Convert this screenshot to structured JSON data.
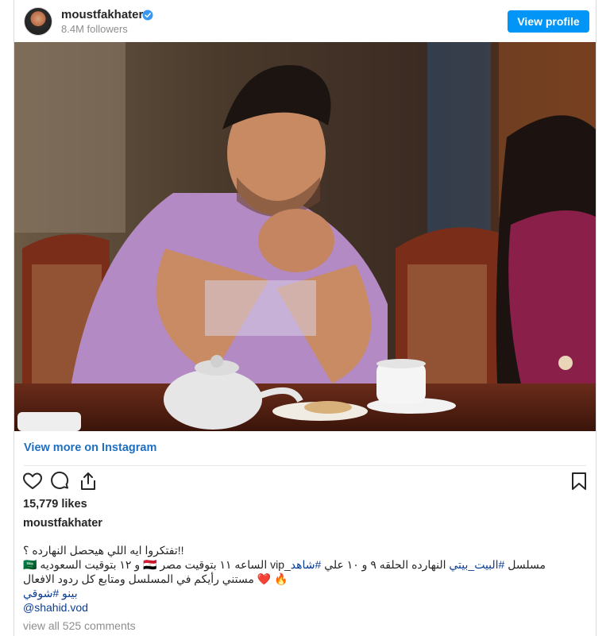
{
  "header": {
    "username": "moustfakhater",
    "followers": "8.4M followers",
    "view_profile_label": "View profile"
  },
  "post": {
    "photo_alt": "",
    "view_more_label": "View more on Instagram",
    "likes": "15,779 likes",
    "owner": "moustfakhater",
    "caption": {
      "line1": "!!تفتكروا ايه اللي هيحصل النهارده ؟",
      "line2_pre": "🇸🇦 و ١٢ بتوقيت السعوديه 🇪🇬 الساعه ١١ بتوقيت مصر ",
      "line2_tag1": "#البيت_بيتي",
      "line2_mid": " vip_مسلسل ",
      "line2_tag0": "",
      "line2_post": " النهارده الحلقه ٩ و ١٠ علي ",
      "line2_tag2": "#شاهد",
      "line3": "🔥 ❤️ مستني رأيكم في المسلسل ومتابع كل ردود الافعال",
      "line4_tag1": "#شوقي",
      "line4_tag2": "بينو",
      "handle": "@shahid.vod"
    },
    "comments_label": "view all 525 comments"
  },
  "icons": {
    "verified": "verified-badge-icon",
    "like": "heart-icon",
    "comment": "comment-bubble-icon",
    "share": "share-icon",
    "save": "bookmark-icon"
  },
  "colors": {
    "accent": "#0095f6",
    "link": "#1e6fc2",
    "text": "#262626",
    "muted": "#8e8e8e"
  }
}
